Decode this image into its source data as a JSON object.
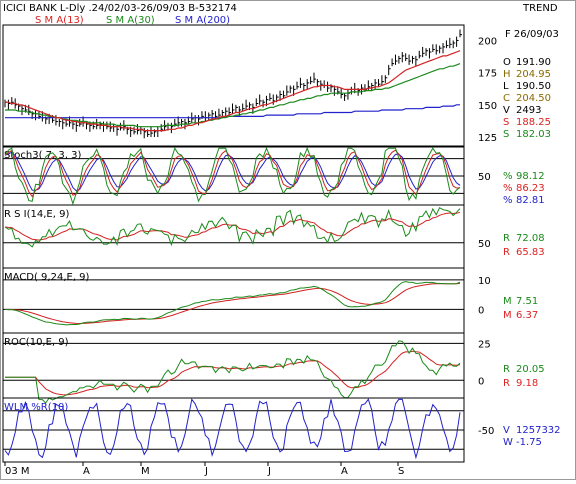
{
  "header": {
    "title": "ICICI BANK L-Dly .24/02/03-26/09/03  B-532174",
    "trend": "TREND",
    "ma_labels": [
      {
        "text": "S M A(13)",
        "color": "#d22"
      },
      {
        "text": "S M A(30)",
        "color": "#1a8a1a"
      },
      {
        "text": "S M A(200)",
        "color": "#2222cc"
      }
    ]
  },
  "colors": {
    "price": "#000000",
    "sma13": "#d22222",
    "sma30": "#1a8a1a",
    "sma200": "#2222cc",
    "stoch_k": "#1a8a1a",
    "stoch_d": "#d22222",
    "stoch_3": "#2222cc",
    "rsi": "#1a8a1a",
    "rsi_sig": "#d22222",
    "wlm": "#2222cc"
  },
  "price_panel": {
    "date_label": "F 26/09/03",
    "ohlc": [
      {
        "key": "O",
        "value": "191.90",
        "color": "#000"
      },
      {
        "key": "H",
        "value": "204.95",
        "color": "#8a6a00"
      },
      {
        "key": "L",
        "value": "190.50",
        "color": "#000"
      },
      {
        "key": "C",
        "value": "204.50",
        "color": "#8a6a00"
      },
      {
        "key": "V",
        "value": "2493",
        "color": "#000"
      },
      {
        "key": "S",
        "value": "188.25",
        "color": "#d22"
      },
      {
        "key": "S",
        "value": "182.03",
        "color": "#1a8a1a"
      }
    ],
    "y_ticks": [
      "200",
      "175",
      "150",
      "125"
    ]
  },
  "stoch_panel": {
    "title": "Stoch3( 7, 3, 3)",
    "y_ticks": [
      "50"
    ],
    "readouts": [
      {
        "key": "%",
        "value": "98.12",
        "color": "#1a8a1a"
      },
      {
        "key": "%",
        "value": "86.23",
        "color": "#d22"
      },
      {
        "key": "%",
        "value": "82.81",
        "color": "#2222cc"
      }
    ]
  },
  "rsi_panel": {
    "title": "R S I(14,E, 9)",
    "y_ticks": [
      "50"
    ],
    "readouts": [
      {
        "key": "R",
        "value": "72.08",
        "color": "#1a8a1a"
      },
      {
        "key": "R",
        "value": "65.83",
        "color": "#d22"
      }
    ]
  },
  "macd_panel": {
    "title": "MACD( 9,24,E, 9)",
    "y_ticks": [
      "10",
      "0"
    ],
    "readouts": [
      {
        "key": "M",
        "value": "7.51",
        "color": "#1a8a1a"
      },
      {
        "key": "M",
        "value": "6.37",
        "color": "#d22"
      }
    ]
  },
  "roc_panel": {
    "title": "ROC(10,E, 9)",
    "y_ticks": [
      "25",
      "0"
    ],
    "readouts": [
      {
        "key": "R",
        "value": "20.05",
        "color": "#1a8a1a"
      },
      {
        "key": "R",
        "value": "9.18",
        "color": "#d22"
      }
    ]
  },
  "wlm_panel": {
    "title": "WLM %R(10)",
    "y_ticks": [
      "-50"
    ],
    "readouts": [
      {
        "key": "V",
        "value": "1257332",
        "color": "#2222cc"
      },
      {
        "key": "W",
        "value": "-1.75",
        "color": "#2222cc"
      }
    ]
  },
  "x_axis": {
    "labels": [
      "03 M",
      "A",
      "M",
      "J",
      "J",
      "A",
      "S"
    ]
  },
  "chart_data": {
    "type": "line",
    "title": "ICICI BANK L-Dly .24/02/03-26/09/03  B-532174",
    "x_categories": [
      "03 M",
      "A",
      "M",
      "J",
      "J",
      "A",
      "S"
    ],
    "price": {
      "ylim": [
        118,
        212
      ],
      "close": [
        152,
        151,
        152,
        150,
        149,
        147,
        146,
        145,
        143,
        143,
        141,
        140,
        139,
        140,
        138,
        137,
        137,
        136,
        135,
        136,
        135,
        134,
        135,
        136,
        135,
        134,
        133,
        134,
        135,
        134,
        133,
        132,
        133,
        131,
        132,
        133,
        131,
        130,
        129,
        130,
        131,
        129,
        127,
        128,
        129,
        130,
        131,
        133,
        134,
        133,
        135,
        136,
        137,
        136,
        137,
        139,
        140,
        139,
        141,
        140,
        142,
        143,
        141,
        142,
        144,
        145,
        144,
        146,
        148,
        146,
        147,
        149,
        150,
        148,
        151,
        153,
        152,
        154,
        155,
        153,
        156,
        158,
        157,
        160,
        163,
        162,
        164,
        166,
        165,
        167,
        168,
        170,
        168,
        166,
        165,
        163,
        164,
        162,
        160,
        158,
        157,
        159,
        160,
        162,
        161,
        163,
        162,
        164,
        165,
        167,
        166,
        168,
        171,
        178,
        182,
        184,
        186,
        188,
        186,
        184,
        186,
        185,
        188,
        190,
        192,
        191,
        193,
        192,
        194,
        195,
        196,
        197,
        198,
        200,
        204.5
      ],
      "sma13": [
        152,
        152,
        151,
        151,
        150,
        150,
        149,
        148,
        147,
        146,
        145,
        144,
        143,
        142,
        141,
        140,
        140,
        139,
        138,
        138,
        137,
        137,
        136,
        136,
        136,
        135,
        135,
        135,
        134,
        134,
        134,
        133,
        133,
        133,
        133,
        132,
        132,
        132,
        131,
        131,
        131,
        130,
        130,
        130,
        130,
        130,
        130,
        130,
        131,
        131,
        131,
        132,
        132,
        133,
        134,
        134,
        135,
        136,
        136,
        137,
        138,
        139,
        139,
        140,
        141,
        141,
        142,
        143,
        144,
        144,
        145,
        146,
        147,
        147,
        148,
        149,
        150,
        150,
        151,
        152,
        153,
        154,
        155,
        156,
        157,
        158,
        159,
        160,
        161,
        162,
        163,
        164,
        164,
        165,
        165,
        165,
        165,
        164,
        164,
        163,
        162,
        162,
        162,
        162,
        162,
        162,
        162,
        163,
        163,
        164,
        164,
        165,
        166,
        167,
        169,
        171,
        173,
        175,
        177,
        178,
        179,
        180,
        181,
        182,
        183,
        184,
        185,
        186,
        187,
        188,
        188,
        189,
        190,
        191,
        192
      ],
      "sma30": [
        146,
        146,
        146,
        146,
        145,
        145,
        145,
        144,
        144,
        143,
        143,
        142,
        142,
        141,
        141,
        140,
        140,
        139,
        139,
        138,
        138,
        138,
        137,
        137,
        137,
        136,
        136,
        136,
        136,
        135,
        135,
        135,
        135,
        134,
        134,
        134,
        134,
        134,
        134,
        133,
        133,
        133,
        133,
        133,
        133,
        133,
        133,
        134,
        134,
        134,
        134,
        134,
        135,
        135,
        135,
        136,
        136,
        136,
        137,
        137,
        138,
        138,
        139,
        139,
        140,
        140,
        141,
        141,
        142,
        142,
        143,
        143,
        144,
        144,
        145,
        146,
        146,
        147,
        148,
        148,
        149,
        150,
        150,
        151,
        152,
        152,
        153,
        154,
        154,
        155,
        155,
        156,
        157,
        157,
        158,
        158,
        159,
        159,
        159,
        159,
        159,
        159,
        160,
        160,
        160,
        160,
        161,
        161,
        161,
        162,
        162,
        162,
        163,
        163,
        164,
        165,
        166,
        167,
        168,
        169,
        170,
        171,
        172,
        173,
        174,
        175,
        176,
        177,
        178,
        178,
        179,
        180,
        180,
        181,
        182
      ],
      "sma200": [
        140,
        140,
        140,
        140,
        140,
        140,
        140,
        140,
        140,
        140,
        140,
        140,
        140,
        140,
        140,
        140,
        140,
        140,
        140,
        140,
        140,
        140,
        140,
        140,
        140,
        140,
        140,
        140,
        140,
        140,
        140,
        140,
        140,
        140,
        140,
        140,
        140,
        140,
        140,
        140,
        140,
        140,
        140,
        140,
        140,
        140,
        140,
        140,
        140,
        140,
        140,
        140,
        140,
        140,
        140,
        140,
        140,
        140,
        140,
        140,
        140,
        140,
        140,
        140,
        140,
        141,
        141,
        141,
        141,
        141,
        141,
        141,
        141,
        141,
        141,
        141,
        141,
        142,
        142,
        142,
        142,
        142,
        142,
        142,
        142,
        142,
        143,
        143,
        143,
        143,
        143,
        143,
        143,
        143,
        144,
        144,
        144,
        144,
        144,
        144,
        144,
        144,
        144,
        145,
        145,
        145,
        145,
        145,
        145,
        145,
        145,
        146,
        146,
        146,
        146,
        146,
        146,
        146,
        147,
        147,
        147,
        147,
        147,
        147,
        148,
        148,
        148,
        148,
        148,
        149,
        149,
        149,
        149,
        150,
        150
      ]
    },
    "stoch": {
      "ylim": [
        0,
        100
      ],
      "ref_lines": [
        80,
        50,
        20
      ]
    },
    "rsi": {
      "ylim": [
        20,
        95
      ],
      "ref_lines": [
        50
      ]
    },
    "macd": {
      "ylim": [
        -8,
        14
      ],
      "ref_lines": [
        10,
        0
      ]
    },
    "roc": {
      "ylim": [
        -12,
        32
      ],
      "ref_lines": [
        25,
        0
      ]
    },
    "wlm": {
      "ylim": [
        -100,
        0
      ],
      "ref_lines": [
        -20,
        -50,
        -80
      ]
    }
  }
}
